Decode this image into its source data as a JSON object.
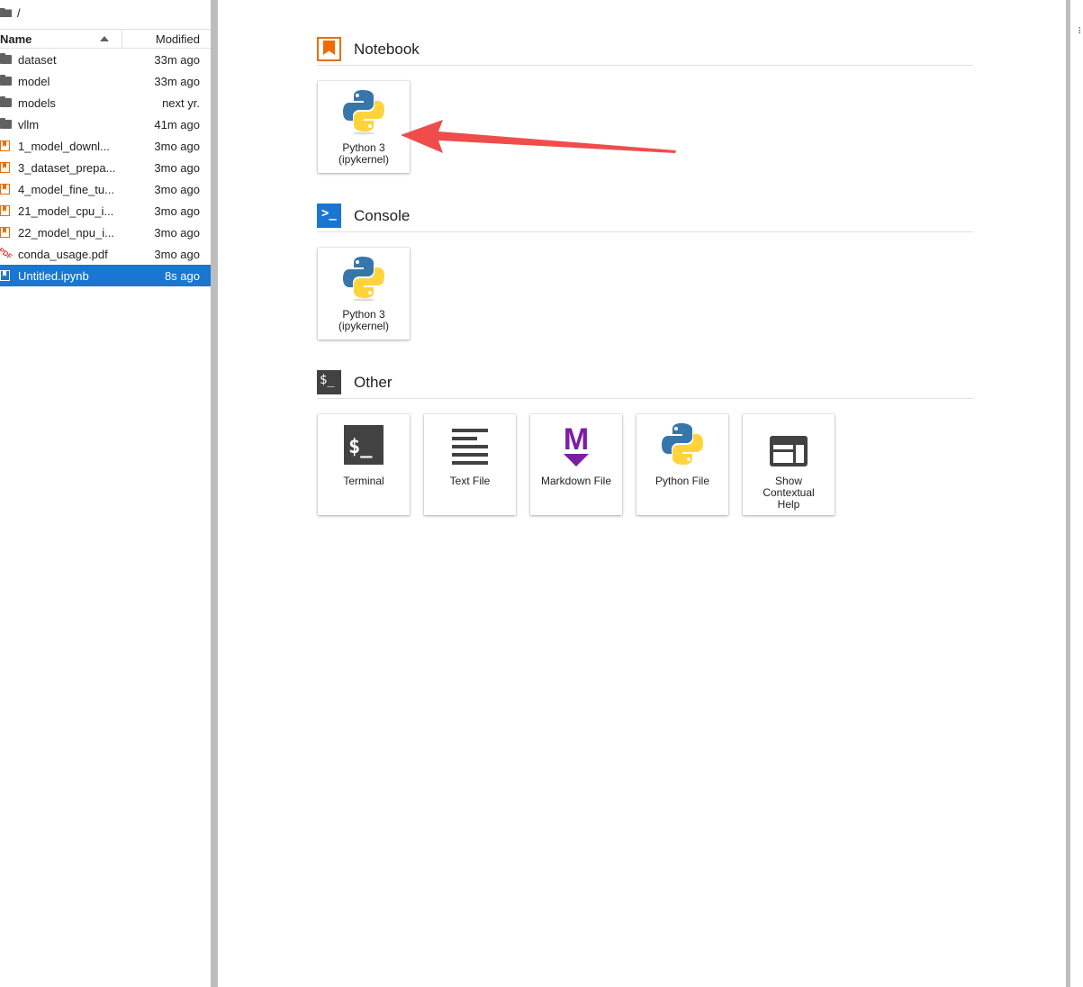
{
  "breadcrumb": {
    "path": "/"
  },
  "listing": {
    "header": {
      "name": "Name",
      "modified": "Modified"
    },
    "rows": [
      {
        "type": "folder",
        "name": "dataset",
        "modified": "33m ago"
      },
      {
        "type": "folder",
        "name": "model",
        "modified": "33m ago"
      },
      {
        "type": "folder",
        "name": "models",
        "modified": "next yr."
      },
      {
        "type": "folder",
        "name": "vllm",
        "modified": "41m ago"
      },
      {
        "type": "notebook",
        "name": "1_model_downl...",
        "modified": "3mo ago"
      },
      {
        "type": "notebook",
        "name": "3_dataset_prepa...",
        "modified": "3mo ago"
      },
      {
        "type": "notebook",
        "name": "4_model_fine_tu...",
        "modified": "3mo ago"
      },
      {
        "type": "notebook",
        "name": "21_model_cpu_i...",
        "modified": "3mo ago"
      },
      {
        "type": "notebook",
        "name": "22_model_npu_i...",
        "modified": "3mo ago"
      },
      {
        "type": "pdf",
        "name": "conda_usage.pdf",
        "modified": "3mo ago",
        "pdf_label": "PDF"
      },
      {
        "type": "notebook",
        "name": "Untitled.ipynb",
        "modified": "8s ago",
        "selected": true
      }
    ]
  },
  "launcher": {
    "notebook": {
      "title": "Notebook",
      "cards": [
        {
          "label_line1": "Python 3",
          "label_line2": "(ipykernel)",
          "icon": "python-icon"
        }
      ]
    },
    "console": {
      "title": "Console",
      "cards": [
        {
          "label_line1": "Python 3",
          "label_line2": "(ipykernel)",
          "icon": "python-icon"
        }
      ]
    },
    "other": {
      "title": "Other",
      "cards": [
        {
          "label": "Terminal",
          "icon": "terminal-icon"
        },
        {
          "label": "Text File",
          "icon": "text-file-icon"
        },
        {
          "label": "Markdown File",
          "icon": "markdown-icon"
        },
        {
          "label": "Python File",
          "icon": "python-icon"
        },
        {
          "label_line1": "Show",
          "label_line2": "Contextual",
          "label_line3": "Help",
          "icon": "contextual-help-icon"
        }
      ]
    }
  },
  "colors": {
    "selection": "#1976d2",
    "notebook_orange": "#ef6c00",
    "annotation_arrow": "#f04c4c",
    "markdown_purple": "#7b1fa2"
  }
}
